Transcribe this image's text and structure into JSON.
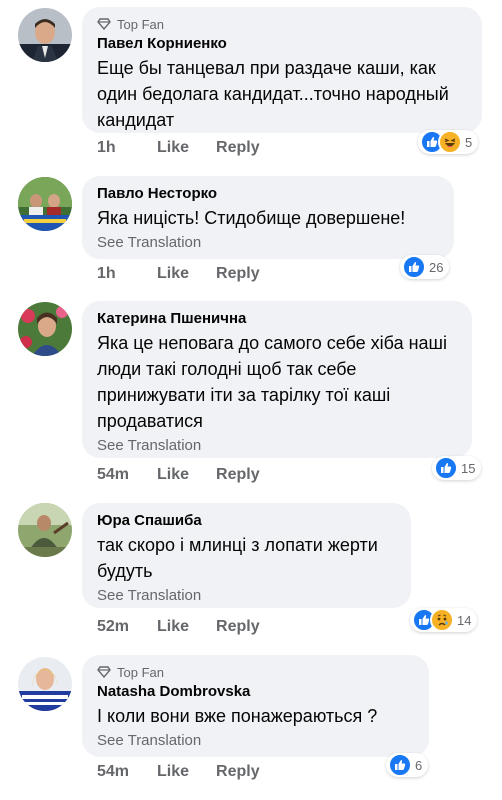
{
  "comments": [
    {
      "top_fan": "Top Fan",
      "name": "Павел Корниенко",
      "text": "Еще бы танцевал при раздаче каши, как один бедолага кандидат...точно народный кандидат",
      "see_translation": "",
      "time": "1h",
      "like": "Like",
      "reply": "Reply",
      "reactions": [
        "like",
        "haha"
      ],
      "reaction_count": "5"
    },
    {
      "top_fan": "",
      "name": "Павло Несторко",
      "text": "Яка ницість! Стидобище довершене!",
      "see_translation": "See Translation",
      "time": "1h",
      "like": "Like",
      "reply": "Reply",
      "reactions": [
        "like"
      ],
      "reaction_count": "26"
    },
    {
      "top_fan": "",
      "name": "Катерина Пшенична",
      "text": "Яка це неповага до самого себе хіба наші люди такі голодні щоб так себе принижувати іти за тарілку тої каші продаватися",
      "see_translation": "See Translation",
      "time": "54m",
      "like": "Like",
      "reply": "Reply",
      "reactions": [
        "like"
      ],
      "reaction_count": "15"
    },
    {
      "top_fan": "",
      "name": "Юра Спашиба",
      "text": "так скоро і млинці з лопати жерти будуть",
      "see_translation": "See Translation",
      "time": "52m",
      "like": "Like",
      "reply": "Reply",
      "reactions": [
        "like",
        "sad"
      ],
      "reaction_count": "14"
    },
    {
      "top_fan": "Top Fan",
      "name": "Natasha Dombrovska",
      "text": "І коли вони вже понажераються ?",
      "see_translation": "See Translation",
      "time": "54m",
      "like": "Like",
      "reply": "Reply",
      "reactions": [
        "like"
      ],
      "reaction_count": "6"
    }
  ],
  "colors": {
    "bubble": "#f0f2f5",
    "like_blue": "#1877f2",
    "muted": "#65676b",
    "emoji_yellow": "#f7b125"
  }
}
